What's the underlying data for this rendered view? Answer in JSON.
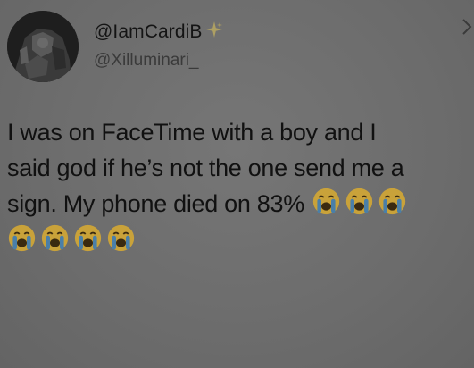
{
  "tweet": {
    "display_name": "@IamCardiB",
    "handle": "@Xilluminari_",
    "lines": [
      "I was on FaceTime with a boy and I",
      "said god if he’s not the one send me a",
      "sign. My phone died on 83%"
    ],
    "inline_emojis": [
      "crying-face",
      "crying-face",
      "crying-face"
    ],
    "trailing_emojis": [
      "crying-face",
      "crying-face",
      "crying-face",
      "crying-face"
    ]
  },
  "colors": {
    "background": "#6e6e6e",
    "text": "#111111",
    "handle_text": "#3a3a3a",
    "sparkle": "#b8a860",
    "emoji_face": "#c9a23a",
    "emoji_tears": "#4a7fa8"
  }
}
